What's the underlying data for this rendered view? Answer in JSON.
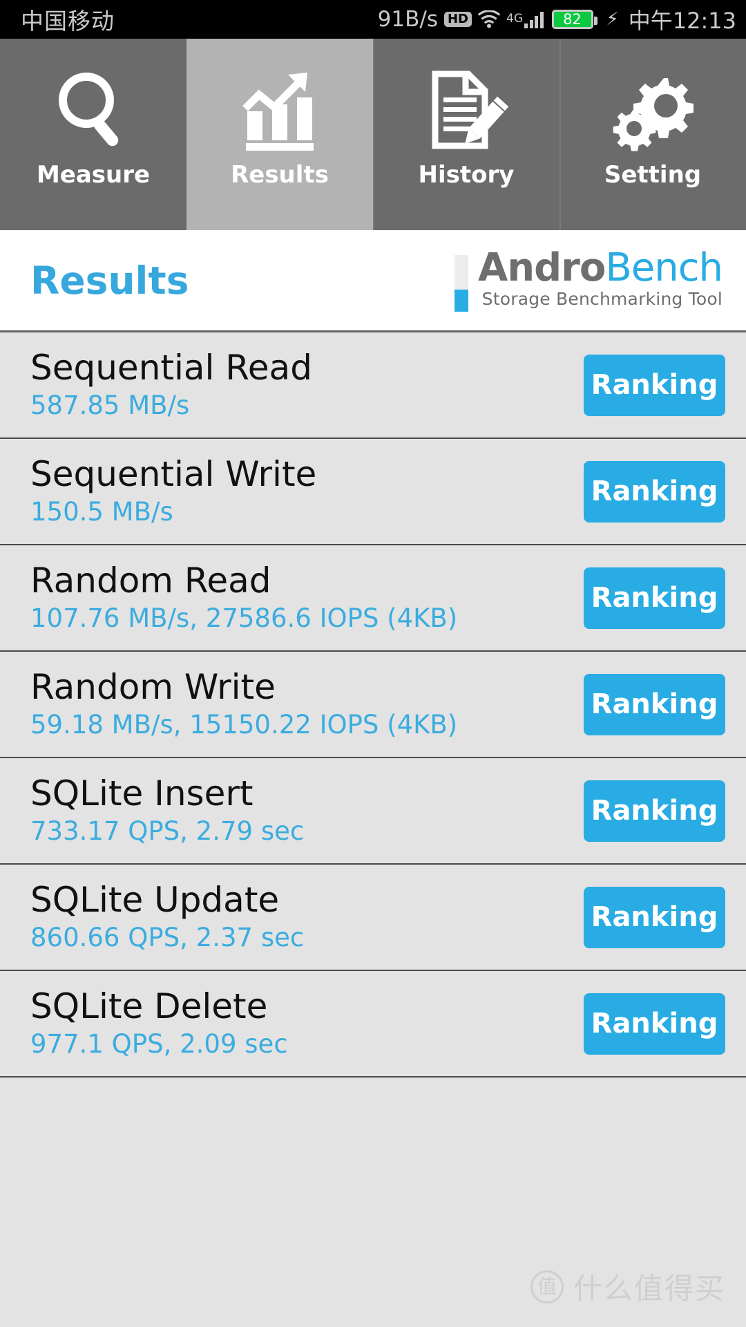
{
  "statusbar": {
    "carrier": "中国移动",
    "network_speed": "91B/s",
    "hd_badge": "HD",
    "wifi_icon": "wifi-icon",
    "network_type": "4G",
    "signal_icon": "signal-bars-icon",
    "battery_level": "82",
    "charging_icon": "lightning-bolt-icon",
    "time": "中午12:13"
  },
  "tabs": [
    {
      "label": "Measure",
      "icon": "magnifier-icon",
      "active": false
    },
    {
      "label": "Results",
      "icon": "bar-chart-trend-icon",
      "active": true
    },
    {
      "label": "History",
      "icon": "document-pencil-icon",
      "active": false
    },
    {
      "label": "Setting",
      "icon": "gears-icon",
      "active": false
    }
  ],
  "header": {
    "page_title": "Results",
    "logo": {
      "name_part1": "Andro",
      "name_part2": "Bench",
      "tagline": "Storage Benchmarking Tool"
    }
  },
  "results": {
    "button_label": "Ranking",
    "rows": [
      {
        "title": "Sequential Read",
        "value": "587.85 MB/s"
      },
      {
        "title": "Sequential Write",
        "value": "150.5 MB/s"
      },
      {
        "title": "Random Read",
        "value": "107.76 MB/s, 27586.6 IOPS (4KB)"
      },
      {
        "title": "Random Write",
        "value": "59.18 MB/s, 15150.22 IOPS (4KB)"
      },
      {
        "title": "SQLite Insert",
        "value": "733.17 QPS, 2.79 sec"
      },
      {
        "title": "SQLite Update",
        "value": "860.66 QPS, 2.37 sec"
      },
      {
        "title": "SQLite Delete",
        "value": "977.1 QPS, 2.09 sec"
      }
    ]
  },
  "watermark": {
    "badge": "值",
    "text": "什么值得买"
  },
  "colors": {
    "accent_blue": "#29ace3",
    "title_blue": "#37a8dd",
    "value_blue": "#3bacdf",
    "tab_inactive": "#6b6b6b",
    "tab_active": "#b3b3b3",
    "list_bg": "#e3e3e3",
    "battery_green": "#0cc93f"
  }
}
